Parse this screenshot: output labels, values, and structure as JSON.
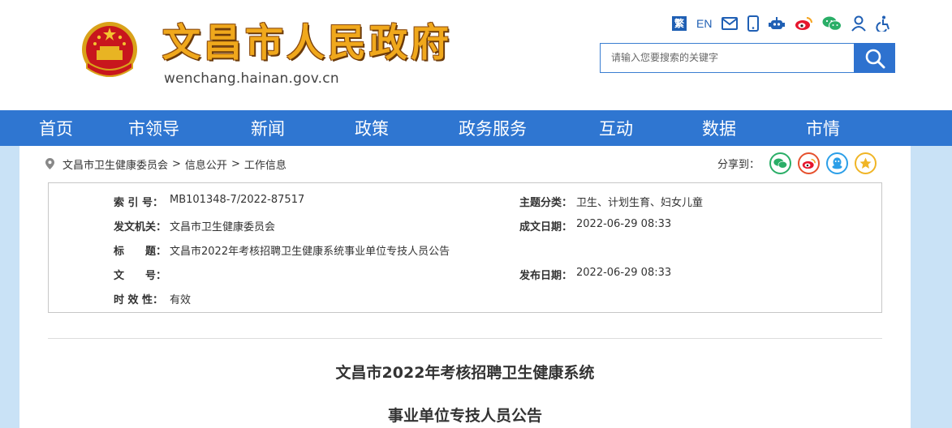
{
  "header": {
    "site_title": "文昌市人民政府",
    "site_domain": "wenchang.hainan.gov.cn",
    "top_links": {
      "traditional": "繁",
      "english": "EN",
      "icons": [
        "mail-icon",
        "mobile-icon",
        "robot-icon",
        "weibo-icon",
        "wechat-icon",
        "user-icon",
        "accessibility-icon"
      ]
    },
    "search": {
      "placeholder": "请输入您要搜索的关键字"
    }
  },
  "nav": {
    "items": [
      "首页",
      "市领导",
      "新闻",
      "政策",
      "政务服务",
      "互动",
      "数据",
      "市情"
    ]
  },
  "breadcrumb": {
    "items": [
      "文昌市卫生健康委员会",
      "信息公开",
      "工作信息"
    ],
    "separator": ">"
  },
  "share": {
    "label": "分享到：",
    "icons": [
      "wechat-icon",
      "weibo-icon",
      "qq-icon",
      "qzone-icon"
    ]
  },
  "info": {
    "index_label": "索 引 号：",
    "index_value": "MB101348-7/2022-87517",
    "topic_label": "主题分类：",
    "topic_value": "卫生、计划生育、妇女儿童",
    "issuer_label": "发文机关：",
    "issuer_value": "文昌市卫生健康委员会",
    "created_label": "成文日期：",
    "created_value": "2022-06-29 08:33",
    "title_label": "标　　题：",
    "title_value": "文昌市2022年考核招聘卫生健康系统事业单位专技人员公告",
    "docno_label": "文　　号：",
    "docno_value": "",
    "published_label": "发布日期：",
    "published_value": "2022-06-29 08:33",
    "validity_label": "时 效 性：",
    "validity_value": "有效"
  },
  "article": {
    "title_line1": "文昌市2022年考核招聘卫生健康系统",
    "title_line2": "事业单位专技人员公告"
  },
  "colors": {
    "nav_bg": "#2f76d1",
    "title_gold": "#f0a81c",
    "page_bg": "#c9e2f6"
  }
}
